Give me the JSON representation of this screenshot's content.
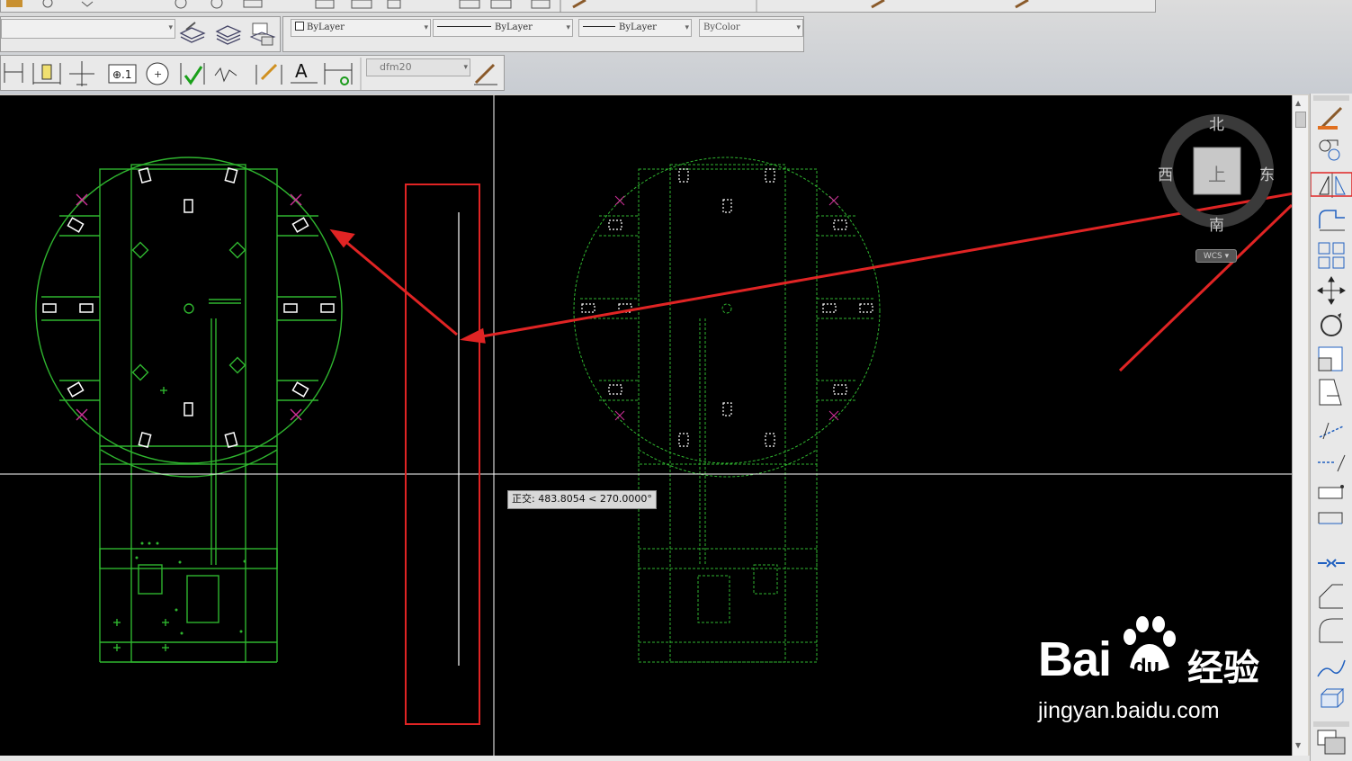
{
  "toolbar": {
    "color_combo": "ByLayer",
    "linetype_combo": "ByLayer",
    "lineweight_combo": "ByLayer",
    "plotstyle_combo": "ByColor",
    "dim_style_combo": "dfm20"
  },
  "viewcube": {
    "north": "北",
    "south": "南",
    "east": "东",
    "west": "西",
    "face": "上",
    "wcs": "WCS"
  },
  "tooltip": "正交: 483.8054 < 270.0000°",
  "watermark": {
    "brand_text": "Bai",
    "paw_text": "du",
    "cn_text": "经验",
    "url": "jingyan.baidu.com"
  },
  "colors": {
    "canvas": "#000000",
    "drawing": "#2fb52f",
    "annotation_red": "#e02424",
    "crosshair": "#ffffff"
  },
  "icons": [
    "paintbrush-icon",
    "layer-icon",
    "match-properties-icon",
    "dimension-linear-icon",
    "dimension-text-icon",
    "tolerance-icon",
    "center-mark-icon",
    "inspect-icon",
    "jogged-icon",
    "edit-icon",
    "text-icon",
    "update-icon",
    "erase-icon",
    "copy-icon",
    "mirror-icon",
    "offset-icon",
    "array-icon",
    "move-icon",
    "rotate-icon",
    "scale-icon",
    "stretch-icon",
    "trim-icon",
    "extend-icon",
    "break-at-point-icon",
    "break-icon",
    "join-icon",
    "chamfer-icon",
    "fillet-icon",
    "blend-icon",
    "explode-icon"
  ]
}
